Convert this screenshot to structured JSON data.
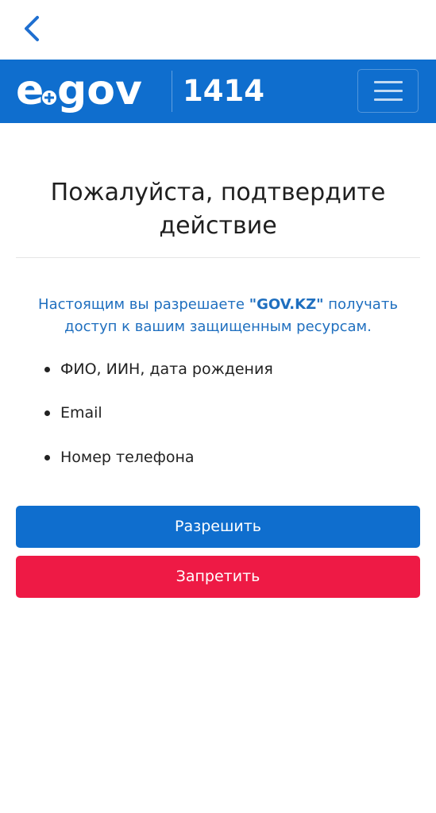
{
  "nav": {
    "back_icon": "chevron-left-icon"
  },
  "header": {
    "logo_text": "egov",
    "hotline": "1414",
    "menu_icon": "hamburger-menu-icon",
    "color": "#0f6ece"
  },
  "consent": {
    "title_line1": "Пожалуйста, подтвердите",
    "title_line2": "действие",
    "intro_prefix": "Настоящим вы разрешаете ",
    "intro_app": "\"GOV.KZ\"",
    "intro_line1_suffix": " получать",
    "intro_line2": "доступ к вашим защищенным ресурсам.",
    "permissions": [
      "ФИО, ИИН, дата рождения",
      "Email",
      "Номер телефона"
    ],
    "allow_label": "Разрешить",
    "deny_label": "Запретить",
    "allow_color": "#0f6ece",
    "deny_color": "#ee1a45"
  }
}
